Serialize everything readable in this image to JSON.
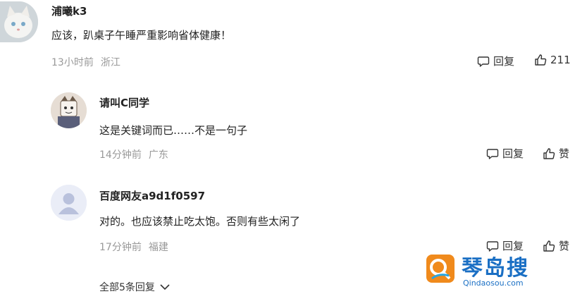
{
  "comment": {
    "user": "浦曦k3",
    "text": "应该，趴桌子午睡严重影响省体健康！",
    "time": "13小时前",
    "location": "浙江",
    "reply_label": "回复",
    "like_count": "211"
  },
  "replies": [
    {
      "user": "请叫C同学",
      "text": "这是关键词而已……不是一句子",
      "time": "14分钟前",
      "location": "广东",
      "reply_label": "回复",
      "like_label": "赞"
    },
    {
      "user": "百度网友a9d1f0597",
      "text": "对的。也应该禁止吃太饱。否则有些太闲了",
      "time": "17分钟前",
      "location": "福建",
      "reply_label": "回复",
      "like_label": "赞"
    }
  ],
  "expand_label": "全部5条回复",
  "watermark": {
    "text": "琴岛搜",
    "url": "Qindaosou.com"
  },
  "colors": {
    "meta": "#999999",
    "text": "#222222",
    "watermark": "#1a6fc4"
  }
}
